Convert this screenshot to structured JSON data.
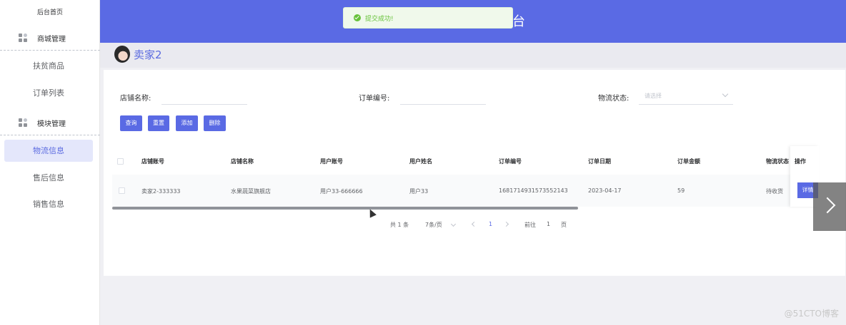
{
  "sidebar": {
    "home": "后台首页",
    "group_mall": "商城管理",
    "group_module": "模块管理",
    "items": [
      {
        "label": "扶贫商品"
      },
      {
        "label": "订单列表"
      },
      {
        "label": "物流信息"
      },
      {
        "label": "售后信息"
      },
      {
        "label": "销售信息"
      }
    ],
    "active_item": "物流信息"
  },
  "header": {
    "title_fragment": "台"
  },
  "toast": {
    "message": "提交成功!",
    "status": "success",
    "color": "#67c23a"
  },
  "user": {
    "name": "卖家2",
    "avatar_icon": "avatar-photo"
  },
  "filters": {
    "shop_name_label": "店铺名称:",
    "order_no_label": "订单编号:",
    "logistics_label": "物流状态:",
    "logistics_placeholder": "请选择"
  },
  "buttons": {
    "search": "查询",
    "reset": "重置",
    "add": "添加",
    "delete": "删除",
    "detail": "详情"
  },
  "table": {
    "columns": [
      "店铺账号",
      "店铺名称",
      "用户账号",
      "用户姓名",
      "订单编号",
      "订单日期",
      "订单金额",
      "物流状态",
      "操作"
    ],
    "rows": [
      [
        "卖家2-333333",
        "水果蔬菜旗舰店",
        "用户33-666666",
        "用户33",
        "1681714931573552143",
        "2023-04-17",
        "59",
        "待收货"
      ]
    ]
  },
  "pagination": {
    "total": "共 1 条",
    "page_size": "7条/页",
    "current": "1",
    "goto_label": "前往",
    "goto_value": "1",
    "page_unit": "页"
  },
  "watermark": "@51CTO博客",
  "colors": {
    "primary": "#5a6ae4",
    "active_bg": "#e4e7fb"
  }
}
